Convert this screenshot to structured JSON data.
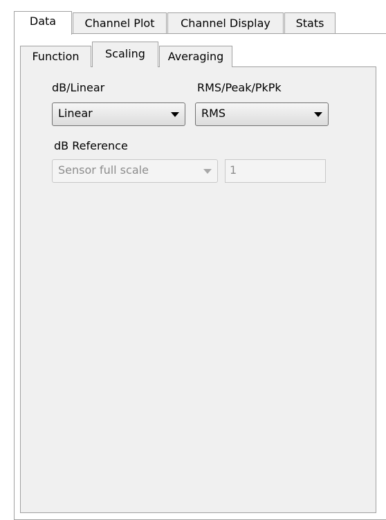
{
  "outer_tabs": [
    {
      "label": "Data",
      "active": true
    },
    {
      "label": "Channel Plot",
      "active": false
    },
    {
      "label": "Channel Display",
      "active": false
    },
    {
      "label": "Stats",
      "active": false
    }
  ],
  "inner_tabs": [
    {
      "label": "Function",
      "active": false
    },
    {
      "label": "Scaling",
      "active": true
    },
    {
      "label": "Averaging",
      "active": false
    }
  ],
  "scaling": {
    "db_linear_label": "dB/Linear",
    "db_linear_value": "Linear",
    "rms_peak_label": "RMS/Peak/PkPk",
    "rms_peak_value": "RMS",
    "db_reference_label": "dB Reference",
    "db_reference_value": "Sensor full scale",
    "db_reference_number": "1",
    "db_reference_enabled": false
  }
}
